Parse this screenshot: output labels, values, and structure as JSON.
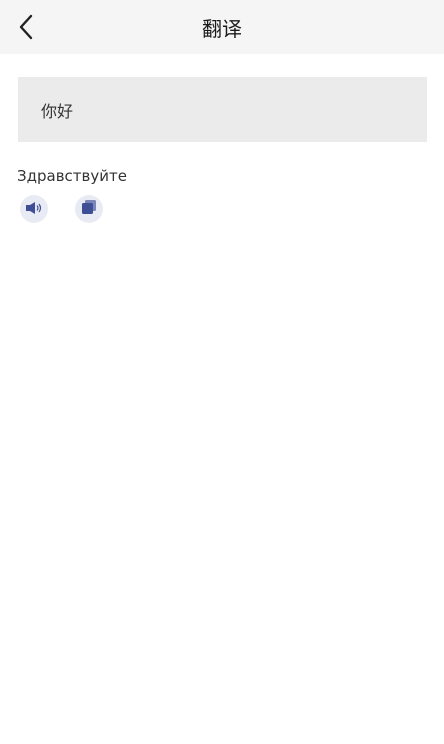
{
  "header": {
    "title": "翻译",
    "back_icon": "chevron-left-icon"
  },
  "source": {
    "text": "你好"
  },
  "result": {
    "text": "Здравствуйте"
  },
  "actions": {
    "speak_icon": "speaker-icon",
    "copy_icon": "copy-icon"
  },
  "colors": {
    "nav_background": "#f5f5f5",
    "source_background": "#ebebeb",
    "icon_accent": "#3f4f95",
    "icon_background": "#e9ebf4"
  }
}
